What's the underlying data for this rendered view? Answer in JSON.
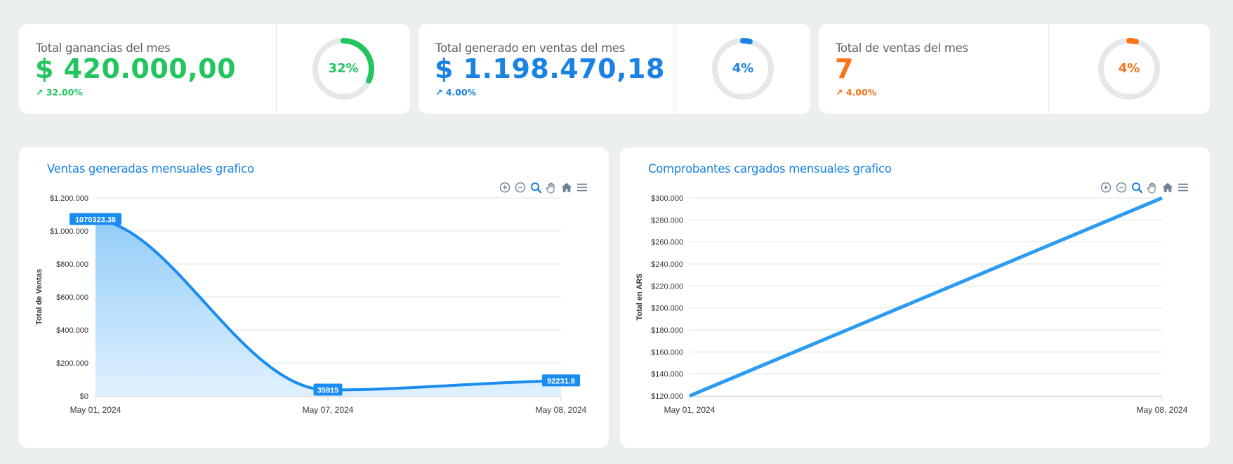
{
  "stats": [
    {
      "label": "Total ganancias del mes",
      "value": "$ 420.000,00",
      "trend": "↗ 32.00%",
      "donut_label": "32%",
      "percent": 32,
      "color": "#22c55e"
    },
    {
      "label": "Total generado en ventas del mes",
      "value": "$ 1.198.470,18",
      "trend": "↗ 4.00%",
      "donut_label": "4%",
      "percent": 4,
      "color": "#1a82e3"
    },
    {
      "label": "Total de ventas del mes",
      "value": "7",
      "trend": "↗ 4.00%",
      "donut_label": "4%",
      "percent": 4,
      "color": "#f97316"
    }
  ],
  "toolbar_icons": [
    "zoom-in-icon",
    "zoom-out-icon",
    "zoom-selection-icon",
    "pan-hand-icon",
    "home-reset-icon",
    "menu-icon"
  ],
  "chart_data": [
    {
      "type": "area",
      "title": "Ventas generadas mensuales grafico",
      "ylabel": "Total de Ventas",
      "x": [
        "May 01, 2024",
        "May 07, 2024",
        "May 08, 2024"
      ],
      "values": [
        1070323.38,
        35915,
        92231.8
      ],
      "data_labels": [
        "1070323.38",
        "35915",
        "92231.8"
      ],
      "ylim": [
        0,
        1200000
      ],
      "yticks": [
        "$0",
        "$200.000",
        "$400.000",
        "$600.000",
        "$800.000",
        "$1.000.000",
        "$1.200.000"
      ],
      "color": "#1a8cf0",
      "grid": true
    },
    {
      "type": "line",
      "title": "Comprobantes cargados mensuales grafico",
      "ylabel": "Total en ARS",
      "x": [
        "May 01, 2024",
        "May 08, 2024"
      ],
      "values": [
        120000,
        300000
      ],
      "ylim": [
        120000,
        300000
      ],
      "yticks": [
        "$120.000",
        "$140.000",
        "$160.000",
        "$180.000",
        "$200.000",
        "$220.000",
        "$240.000",
        "$260.000",
        "$280.000",
        "$300.000"
      ],
      "color": "#2b9cf2",
      "grid": true
    }
  ]
}
